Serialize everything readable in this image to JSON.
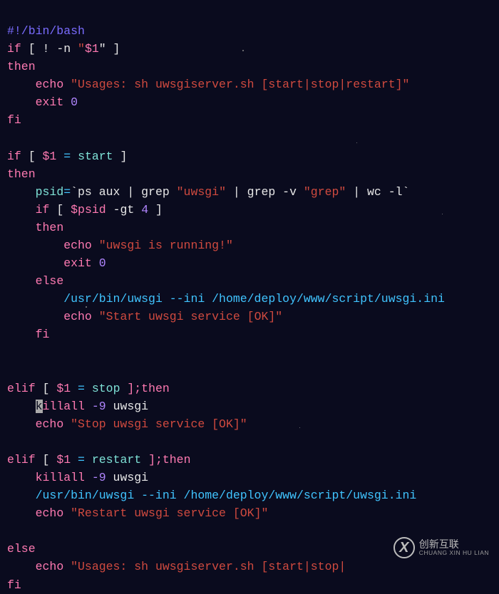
{
  "lines": {
    "l1": "#!/bin/bash",
    "if1_a": "if",
    "if1_b": "[ ! -n ",
    "if1_q": "\"",
    "if1_v": "$1",
    "if1_c": "\" ]",
    "then": "then",
    "echo": "echo",
    "usages": "\"Usages: sh uwsgiserver.sh [start|stop|restart]\"",
    "exit": "exit",
    "zero": "0",
    "fi": "fi",
    "if2_a": "if",
    "if2_b": " [ ",
    "if2_v": "$1",
    "eq": "=",
    "start": "start",
    "if2_c": " ]",
    "psid": "psid",
    "eqs": "=",
    "bq": "`",
    "psaux": "ps aux | grep ",
    "uwsgi": "\"uwsgi\"",
    "grepv": " | grep -v ",
    "grep": "\"grep\"",
    "wcl": " | wc -l",
    "if3_b": "[ ",
    "psidv": "$psid",
    "gt": "-gt",
    "four": "4",
    "if3_c": " ]",
    "run": "\"uwsgi is running!\"",
    "else": "else",
    "binpath": "/usr/bin/uwsgi --ini /home/deploy/www/script/uwsgi.ini",
    "startok": "\"Start uwsgi service [OK]\"",
    "elif": "elif",
    "stop": "stop",
    "semi_then": "];then",
    "killall": "killall",
    "nine": "-9",
    "uwsgi_w": "uwsgi",
    "stopok": "\"Stop uwsgi service [OK]\"",
    "restart": "restart",
    "restartok": "\"Restart uwsgi service [OK]\"",
    "usages2": "\"Usages: sh uwsgiserver.sh [start|stop|"
  },
  "watermark": {
    "main": "创新互联",
    "sub": "CHUANG XIN HU LIAN",
    "logo": "X"
  }
}
